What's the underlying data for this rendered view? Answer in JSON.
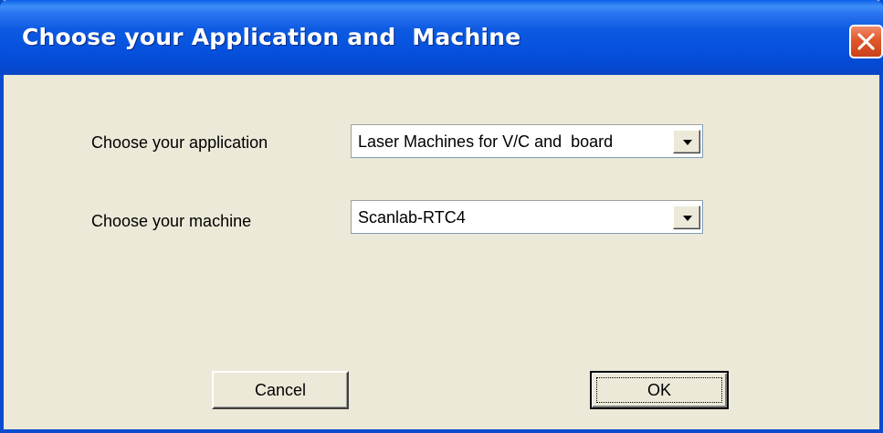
{
  "window": {
    "title": "Choose your Application and  Machine"
  },
  "form": {
    "application_label": "Choose your application",
    "application_value": "Laser Machines for V/C and  board",
    "machine_label": "Choose your machine",
    "machine_value": "Scanlab-RTC4"
  },
  "buttons": {
    "cancel": "Cancel",
    "ok": "OK"
  },
  "colors": {
    "titlebar": "#0550dc",
    "client": "#ece9d8",
    "close_button": "#e2572a"
  },
  "icons": {
    "close": "close-icon",
    "dropdown": "chevron-down-icon"
  }
}
